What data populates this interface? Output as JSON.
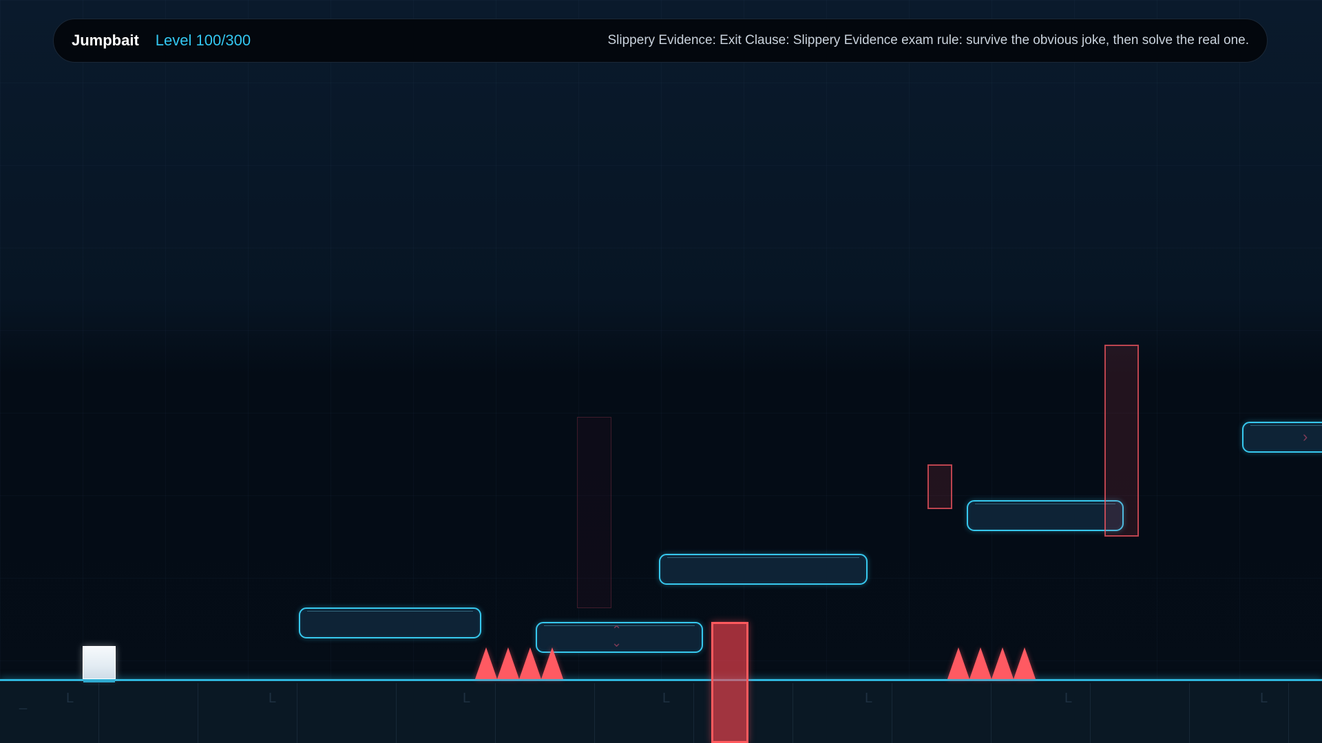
{
  "hud": {
    "game_title": "Jumpbait",
    "level_prefix": "Level",
    "level_current": "100",
    "level_total": "300",
    "level_description": "Slippery Evidence: Exit Clause: Slippery Evidence exam rule: survive the obvious joke, then solve the real one."
  },
  "colors": {
    "accent": "#33c6f0",
    "hazard": "#ff5a62",
    "platform_fill": "#0e2336",
    "background": "#071220"
  },
  "icons": {
    "vertical_mover": "up-down-arrows-icon",
    "horizontal_mover": "chevron-right-icon"
  }
}
